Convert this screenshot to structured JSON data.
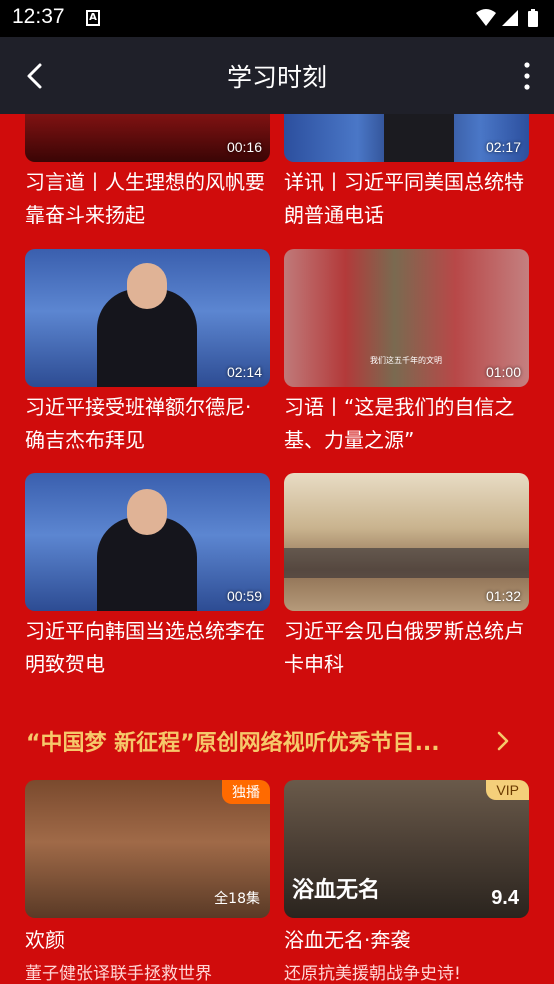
{
  "status": {
    "time": "12:37",
    "a_icon": "A"
  },
  "app_bar": {
    "title": "学习时刻"
  },
  "videos": [
    {
      "title": "习言道丨人生理想的风帆要靠奋斗来扬起",
      "duration": "00:16"
    },
    {
      "title": "详讯丨习近平同美国总统特朗普通电话",
      "duration": "02:17"
    },
    {
      "title": "习近平接受班禅额尔德尼·确吉杰布拜见",
      "duration": "02:14"
    },
    {
      "title": "习语丨“这是我们的自信之基、力量之源”",
      "duration": "01:00",
      "overlay_text": "我们这五千年的文明"
    },
    {
      "title": "习近平向韩国当选总统李在明致贺电",
      "duration": "00:59"
    },
    {
      "title": "习近平会见白俄罗斯总统卢卡申科",
      "duration": "01:32"
    }
  ],
  "section": {
    "title": "“中国梦 新征程”原创网络视听优秀节目..."
  },
  "programs": [
    {
      "title": "欢颜",
      "subtitle": "董子健张译联手拯救世界",
      "tag": "独播",
      "episodes": "全18集"
    },
    {
      "title": "浴血无名·奔袭",
      "subtitle": "还原抗美援朝战争史诗!",
      "tag": "VIP",
      "rating": "9.4",
      "poster_text": "浴血无名"
    }
  ],
  "colors": {
    "background": "#d00c0c",
    "app_bar": "#1f2029",
    "section_title": "#f6c86a"
  }
}
